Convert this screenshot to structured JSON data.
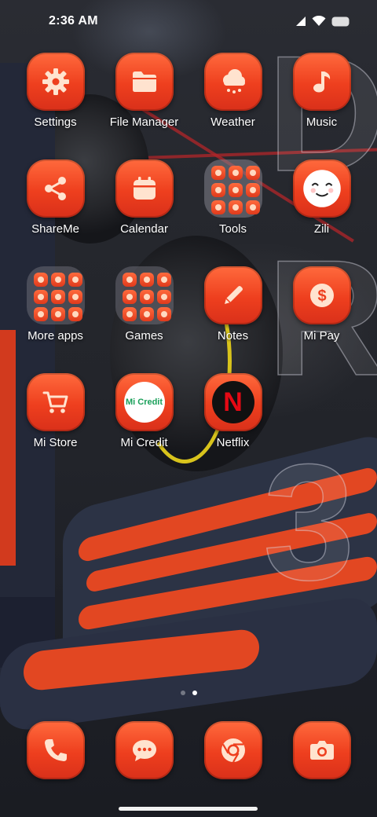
{
  "status_bar": {
    "time": "2:36 AM",
    "icons": [
      "signal-icon",
      "wifi-icon",
      "battery-icon"
    ]
  },
  "wallpaper": {
    "letters": [
      "D",
      "R",
      "3"
    ]
  },
  "apps": [
    {
      "label": "Settings",
      "icon": "gear-icon"
    },
    {
      "label": "File Manager",
      "icon": "folder-icon"
    },
    {
      "label": "Weather",
      "icon": "cloud-rain-icon"
    },
    {
      "label": "Music",
      "icon": "music-note-icon"
    },
    {
      "label": "ShareMe",
      "icon": "share-icon"
    },
    {
      "label": "Calendar",
      "icon": "calendar-icon"
    },
    {
      "label": "Tools",
      "icon": "folder-tools-icon"
    },
    {
      "label": "Zili",
      "icon": "smiley-face-icon"
    },
    {
      "label": "More apps",
      "icon": "folder-more-apps-icon"
    },
    {
      "label": "Games",
      "icon": "folder-games-icon"
    },
    {
      "label": "Notes",
      "icon": "pencil-icon"
    },
    {
      "label": "Mi Pay",
      "icon": "dollar-coin-icon"
    },
    {
      "label": "Mi Store",
      "icon": "shopping-cart-icon"
    },
    {
      "label": "Mi Credit",
      "icon": "mi-credit-logo-icon",
      "logo_text": "Mi Credit"
    },
    {
      "label": "Netflix",
      "icon": "netflix-logo-icon",
      "logo_text": "N"
    }
  ],
  "pager": {
    "pages": 2,
    "active": 2
  },
  "dock": [
    {
      "name": "phone",
      "icon": "phone-icon"
    },
    {
      "name": "messages",
      "icon": "message-bubble-icon"
    },
    {
      "name": "browser",
      "icon": "chrome-icon"
    },
    {
      "name": "camera",
      "icon": "camera-icon"
    }
  ],
  "colors": {
    "icon_gradient_top": "#ff6a3d",
    "icon_gradient_bottom": "#d9301a",
    "glyph": "#ffe3cf"
  }
}
